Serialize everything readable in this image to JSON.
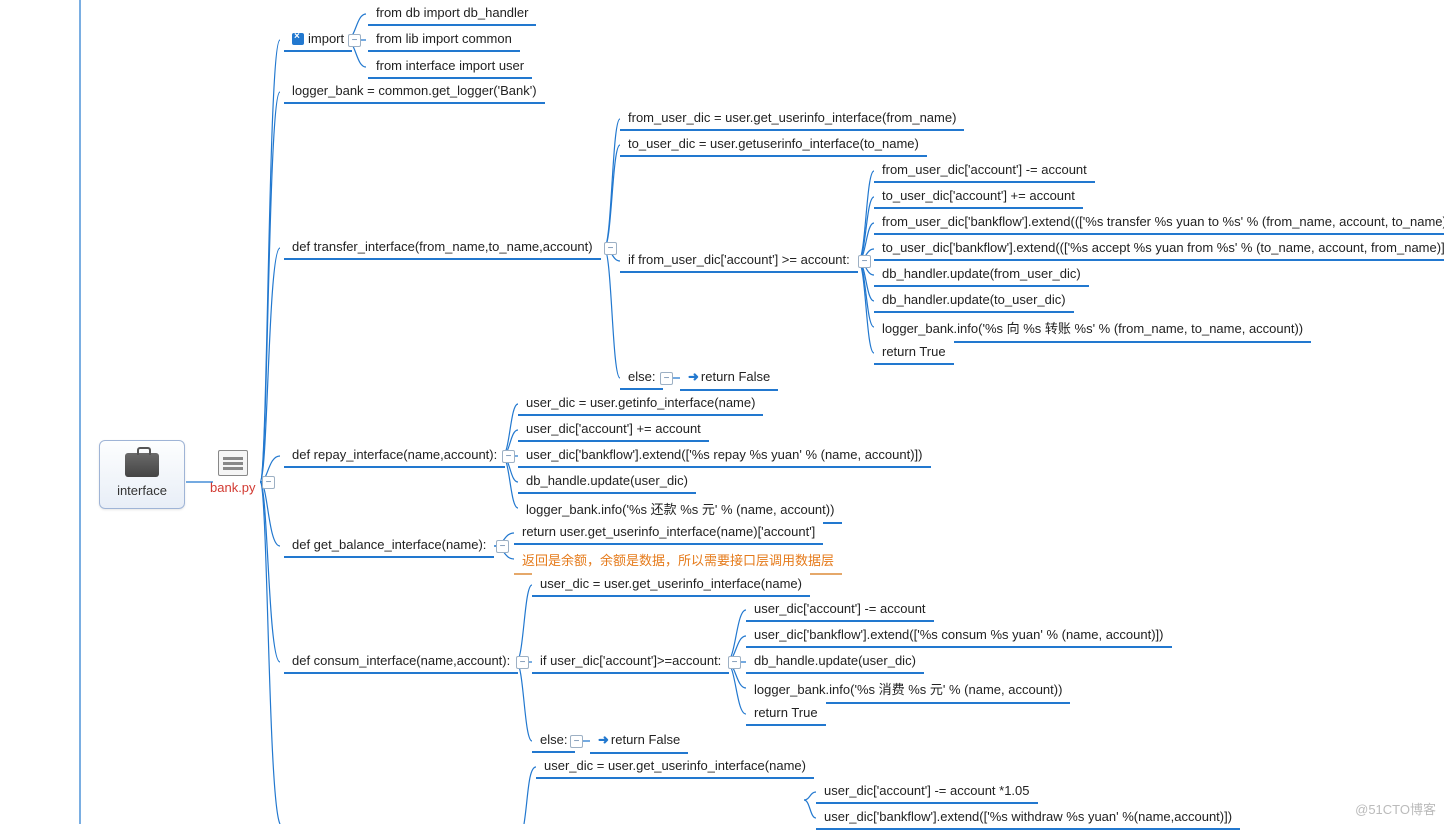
{
  "root": {
    "label": "interface"
  },
  "file": {
    "name": "bank.py"
  },
  "nodes": {
    "import_label": "import",
    "import": {
      "c0": "from db import db_handler",
      "c1": "from lib import common",
      "c2": "from interface import user"
    },
    "logger": "logger_bank = common.get_logger('Bank')",
    "transfer": {
      "def": "def transfer_interface(from_name,to_name,account)",
      "c0": "from_user_dic = user.get_userinfo_interface(from_name)",
      "c1": "to_user_dic = user.getuserinfo_interface(to_name)",
      "c2": "if from_user_dic['account'] >= account:",
      "if": {
        "c0": "from_user_dic['account'] -= account",
        "c1": "to_user_dic['account'] += account",
        "c2": "from_user_dic['bankflow'].extend((['%s transfer %s yuan to %s' % (from_name, account, to_name)]))",
        "c3": "to_user_dic['bankflow'].extend((['%s accept %s yuan from %s' % (to_name, account, from_name)]))",
        "c4": "db_handler.update(from_user_dic)",
        "c5": "db_handler.update(to_user_dic)",
        "c6": "logger_bank.info('%s 向 %s 转账 %s' % (from_name, to_name, account))",
        "c7": "return True"
      },
      "else": "else:",
      "else_ret": "return False"
    },
    "repay": {
      "def": "def repay_interface(name,account):",
      "c0": "user_dic = user.getinfo_interface(name)",
      "c1": "user_dic['account'] += account",
      "c2": "user_dic['bankflow'].extend(['%s repay %s yuan' % (name, account)])",
      "c3": "db_handle.update(user_dic)",
      "c4": "logger_bank.info('%s 还款 %s 元' % (name, account))"
    },
    "getbal": {
      "def": "def get_balance_interface(name):",
      "c0": "return user.get_userinfo_interface(name)['account']",
      "hint": "返回是余额，余额是数据，所以需要接口层调用数据层"
    },
    "consum": {
      "def": "def consum_interface(name,account):",
      "c0": "user_dic = user.get_userinfo_interface(name)",
      "c1": "if user_dic['account']>=account:",
      "if": {
        "c0": "user_dic['account'] -= account",
        "c1": "user_dic['bankflow'].extend(['%s consum %s yuan' % (name, account)])",
        "c2": "db_handle.update(user_dic)",
        "c3": "logger_bank.info('%s 消费 %s 元' % (name, account))",
        "c4": "return True"
      },
      "else": "else:",
      "else_ret": "return False"
    },
    "withdraw": {
      "c0": "user_dic = user.get_userinfo_interface(name)",
      "if": {
        "c0": "user_dic['account'] -= account *1.05",
        "c1": "user_dic['bankflow'].extend(['%s withdraw %s yuan' %(name,account)])"
      }
    }
  },
  "watermark": "@51CTO博客"
}
